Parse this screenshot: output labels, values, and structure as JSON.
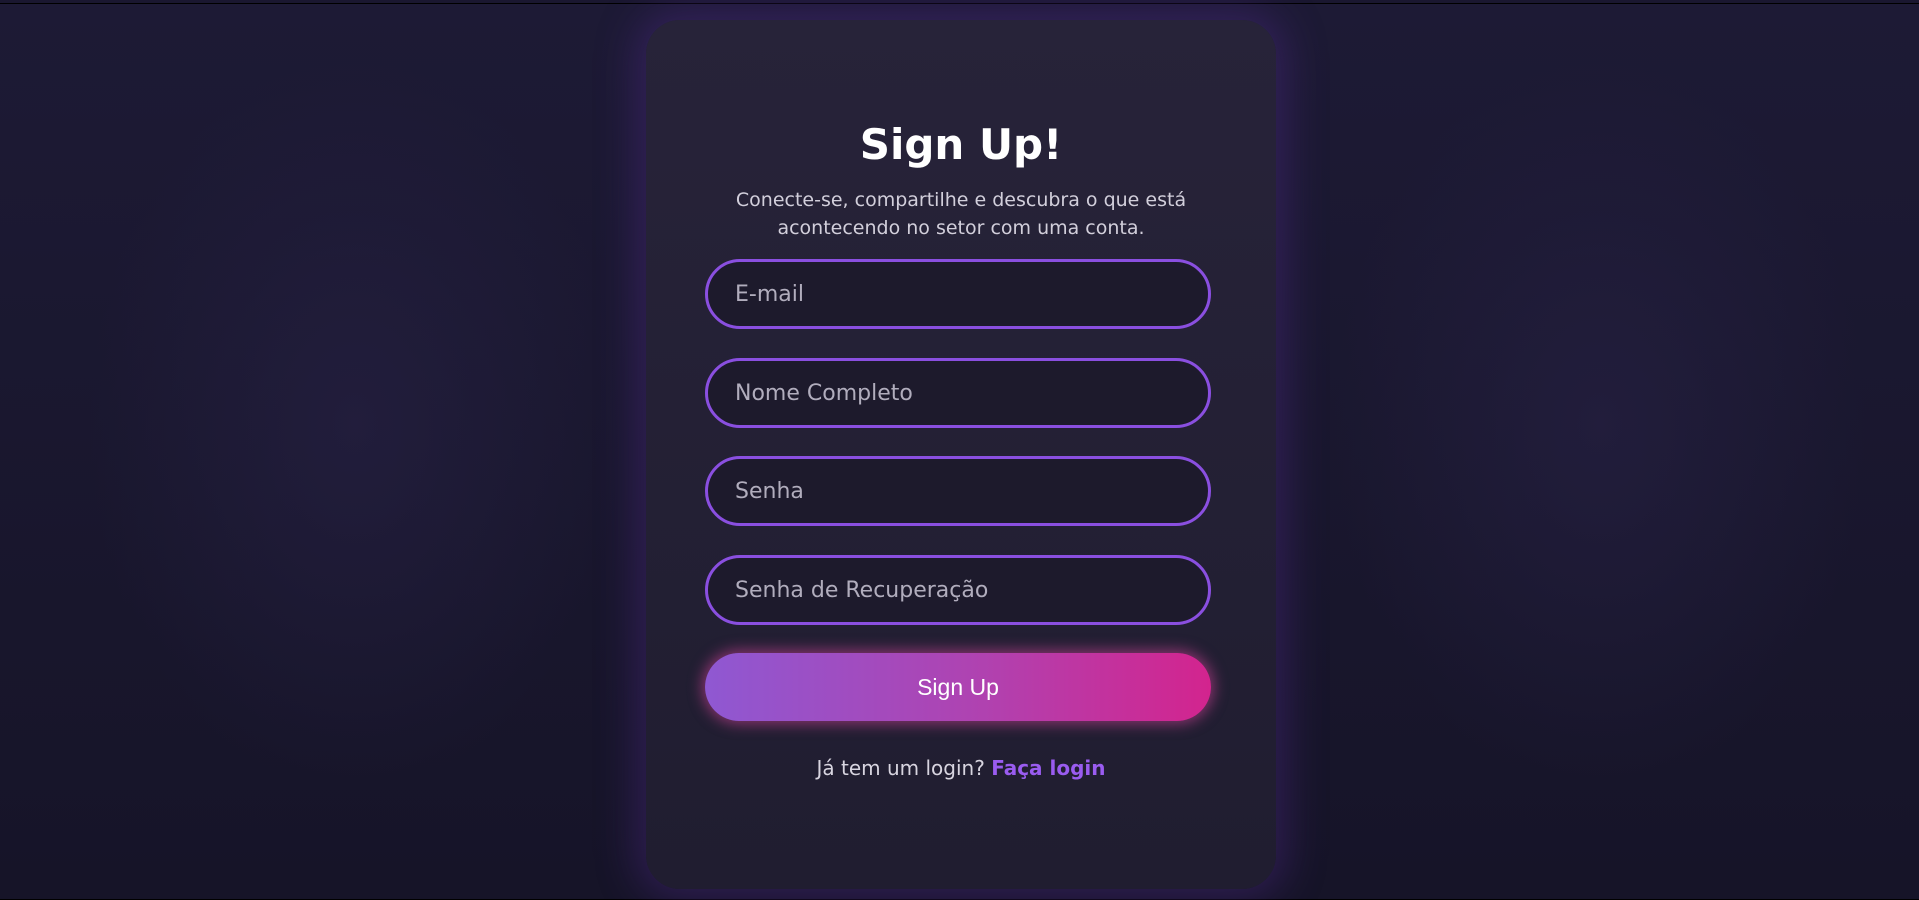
{
  "form": {
    "title": "Sign Up!",
    "subtitle": "Conecte-se, compartilhe e descubra o que está acontecendo no setor com uma conta.",
    "fields": [
      {
        "placeholder": "E-mail",
        "value": ""
      },
      {
        "placeholder": "Nome Completo",
        "value": ""
      },
      {
        "placeholder": "Senha",
        "value": ""
      },
      {
        "placeholder": "Senha de Recuperação",
        "value": ""
      }
    ],
    "submit_label": "Sign Up",
    "login_prompt": "Já tem um login?",
    "login_link": "Faça login"
  },
  "colors": {
    "accent": "#8a4fe0",
    "button_gradient_start": "#8f58d2",
    "button_gradient_end": "#d3248e",
    "background": "#1a1730",
    "card": "#242034"
  }
}
